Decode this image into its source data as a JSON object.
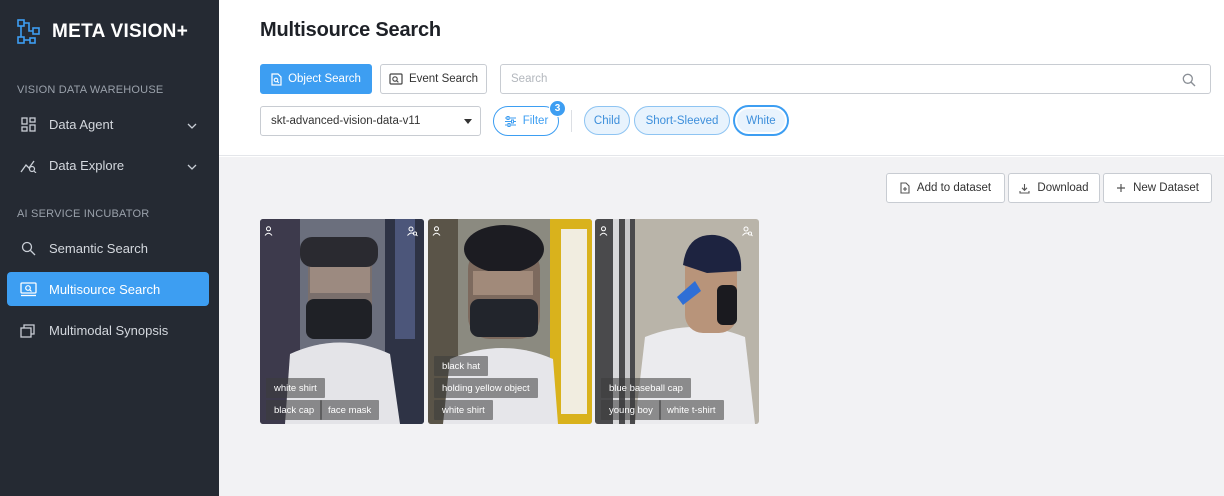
{
  "app": {
    "name": "META VISION+"
  },
  "sidebar": {
    "sections": [
      {
        "label": "VISION DATA WAREHOUSE"
      },
      {
        "label": "AI SERVICE INCUBATOR"
      }
    ],
    "items": [
      {
        "label": "Data Agent",
        "icon": "grid-icon"
      },
      {
        "label": "Data Explore",
        "icon": "chart-explore-icon"
      },
      {
        "label": "Semantic Search",
        "icon": "search-icon"
      },
      {
        "label": "Multisource Search",
        "icon": "monitor-search-icon",
        "active": true
      },
      {
        "label": "Multimodal Synopsis",
        "icon": "stack-icon"
      }
    ]
  },
  "header": {
    "title": "Multisource Search",
    "tabs": [
      {
        "label": "Object Search",
        "active": true
      },
      {
        "label": "Event Search"
      }
    ],
    "search": {
      "placeholder": "Search",
      "value": ""
    },
    "dataset_select": {
      "value": "skt-advanced-vision-data-v11"
    },
    "filter": {
      "label": "Filter",
      "count": "3"
    },
    "chips": [
      {
        "label": "Child"
      },
      {
        "label": "Short-Sleeved"
      },
      {
        "label": "White",
        "selected": true
      }
    ]
  },
  "toolbar": {
    "add_to_dataset": "Add to dataset",
    "download": "Download",
    "new_dataset": "New Dataset"
  },
  "results": [
    {
      "tags_row1": [
        "white shirt"
      ],
      "tags_row2": [
        "black cap",
        "face mask"
      ]
    },
    {
      "tags_row0": [
        "black hat"
      ],
      "tags_row1": [
        "holding yellow object"
      ],
      "tags_row2": [
        "white shirt"
      ]
    },
    {
      "tags_row1": [
        "blue baseball cap"
      ],
      "tags_row2": [
        "young boy",
        "white t-shirt"
      ]
    }
  ],
  "colors": {
    "accent": "#3d9ef2",
    "sidebar_bg": "#252a33",
    "content_bg": "#f2f2f4"
  }
}
